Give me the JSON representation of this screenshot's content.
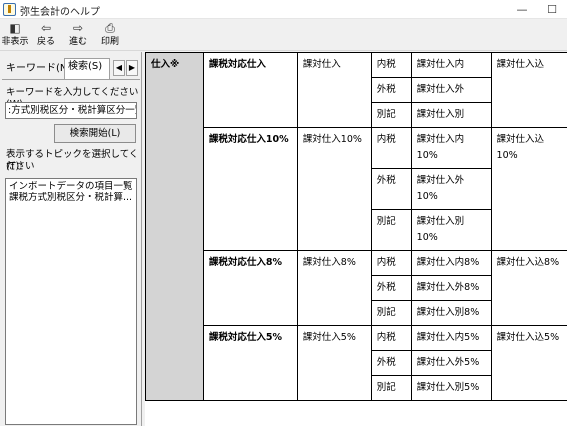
{
  "window": {
    "title": "弥生会計のヘルプ",
    "minimize_glyph": "—",
    "maximize_glyph": "☐"
  },
  "toolbar": {
    "hide": {
      "label": "非表示",
      "icon": "hide-icon",
      "glyph": "◧"
    },
    "back": {
      "label": "戻る",
      "icon": "back-arrow-icon",
      "glyph": "⇦"
    },
    "forward": {
      "label": "進む",
      "icon": "forward-arrow-icon",
      "glyph": "⇨"
    },
    "print": {
      "label": "印刷",
      "icon": "printer-icon",
      "glyph": "⎙"
    }
  },
  "nav": {
    "tab_keyword": "キーワード(N)",
    "tab_search": "検索(S)",
    "left_arrow": "◀",
    "right_arrow": "▶",
    "keyword_label": "キーワードを入力してください(W):",
    "keyword_value": ":方式別税区分・税計算区分一覧",
    "search_button": "検索開始(L)",
    "topic_label_1": "表示するトピックを選択してください",
    "topic_label_2": "(T):",
    "topics": [
      "インポートデータの項目一覧",
      "課税方式別税区分・税計算..."
    ]
  },
  "help_table": {
    "category": "仕入※",
    "groups": [
      {
        "name": "課税対応仕入",
        "item": "課対仕入",
        "rows": [
          {
            "kind": "内税",
            "sub": "課対仕入内"
          },
          {
            "kind": "外税",
            "sub": "課対仕入外"
          },
          {
            "kind": "別記",
            "sub": "課対仕入別"
          }
        ],
        "summary": "課対仕入込"
      },
      {
        "name": "課税対応仕入10%",
        "item": "課対仕入10%",
        "rows": [
          {
            "kind": "内税",
            "sub": "課対仕入内\n10%"
          },
          {
            "kind": "外税",
            "sub": "課対仕入外\n10%"
          },
          {
            "kind": "別記",
            "sub": "課対仕入別\n10%"
          }
        ],
        "summary": "課対仕入込\n10%"
      },
      {
        "name": "課税対応仕入8%",
        "item": "課対仕入8%",
        "rows": [
          {
            "kind": "内税",
            "sub": "課対仕入内8%"
          },
          {
            "kind": "外税",
            "sub": "課対仕入外8%"
          },
          {
            "kind": "別記",
            "sub": "課対仕入別8%"
          }
        ],
        "summary": "課対仕入込8%"
      },
      {
        "name": "課税対応仕入5%",
        "item": "課対仕入5%",
        "rows": [
          {
            "kind": "内税",
            "sub": "課対仕入内5%"
          },
          {
            "kind": "外税",
            "sub": "課対仕入外5%"
          },
          {
            "kind": "別記",
            "sub": "課対仕入別5%"
          }
        ],
        "summary": "課対仕入込5%"
      }
    ]
  }
}
